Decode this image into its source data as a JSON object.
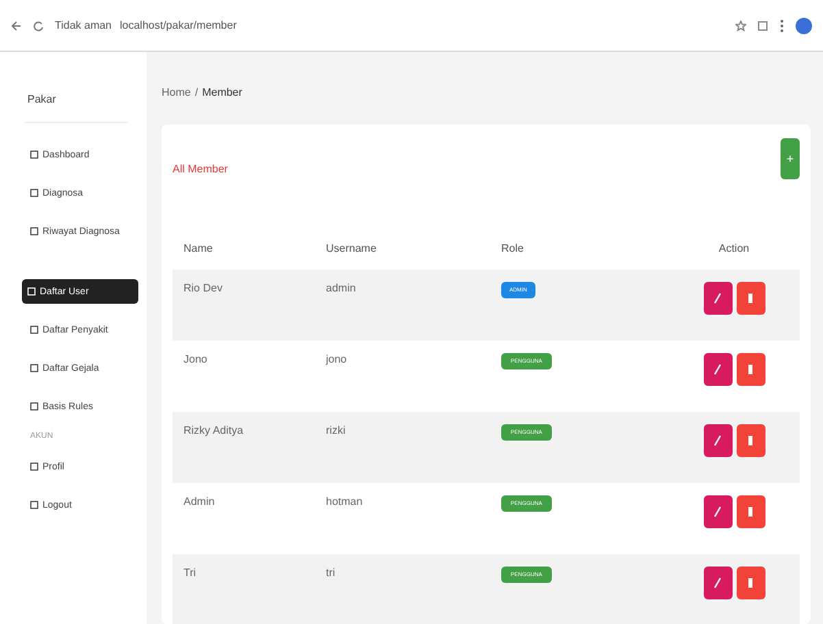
{
  "browser": {
    "security": "Tidak aman",
    "url": "localhost/pakar/member"
  },
  "sidebar": {
    "brand": "Pakar",
    "items": [
      {
        "label": "Dashboard",
        "selected": false
      },
      {
        "label": "Diagnosa",
        "selected": false
      },
      {
        "label": "Riwayat Diagnosa",
        "selected": false
      },
      {
        "label": "Daftar User",
        "selected": true
      },
      {
        "label": "Daftar Penyakit",
        "selected": false
      },
      {
        "label": "Daftar Gejala",
        "selected": false
      },
      {
        "label": "Basis Rules",
        "selected": false
      }
    ],
    "section": "AKUN",
    "account_items": [
      {
        "label": "Profil",
        "selected": false
      },
      {
        "label": "Logout",
        "selected": false
      }
    ]
  },
  "breadcrumb": {
    "parent": "Home",
    "separator": "/",
    "current": "Member"
  },
  "card": {
    "title": "All Member",
    "add_button": "+"
  },
  "table": {
    "columns": [
      "Name",
      "Username",
      "Role",
      "Action"
    ],
    "rows": [
      {
        "name": "Rio Dev",
        "username": "admin",
        "role": "ADMIN",
        "kind": "admin"
      },
      {
        "name": "Jono",
        "username": "jono",
        "role": "PENGGUNA",
        "kind": "user"
      },
      {
        "name": "Rizky Aditya",
        "username": "rizki",
        "role": "PENGGUNA",
        "kind": "user"
      },
      {
        "name": "Admin",
        "username": "hotman",
        "role": "PENGGUNA",
        "kind": "user"
      },
      {
        "name": "Tri",
        "username": "tri",
        "role": "PENGGUNA",
        "kind": "user"
      }
    ]
  }
}
